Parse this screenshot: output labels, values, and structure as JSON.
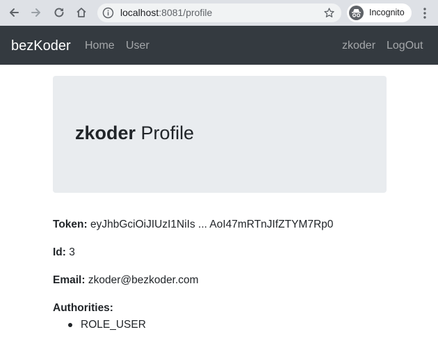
{
  "browser": {
    "url_host": "localhost",
    "url_rest": ":8081/profile",
    "incognito_label": "Incognito"
  },
  "navbar": {
    "brand": "bezKoder",
    "home": "Home",
    "user": "User",
    "profile": "zkoder",
    "logout": "LogOut"
  },
  "profile": {
    "username": "zkoder",
    "title_suffix": "Profile",
    "token_label": "Token:",
    "token_value": "eyJhbGciOiJIUzI1NiIs ... AoI47mRTnJIfZTYM7Rp0",
    "id_label": "Id:",
    "id_value": "3",
    "email_label": "Email:",
    "email_value": "zkoder@bezkoder.com",
    "authorities_label": "Authorities:",
    "authorities": [
      "ROLE_USER"
    ]
  }
}
